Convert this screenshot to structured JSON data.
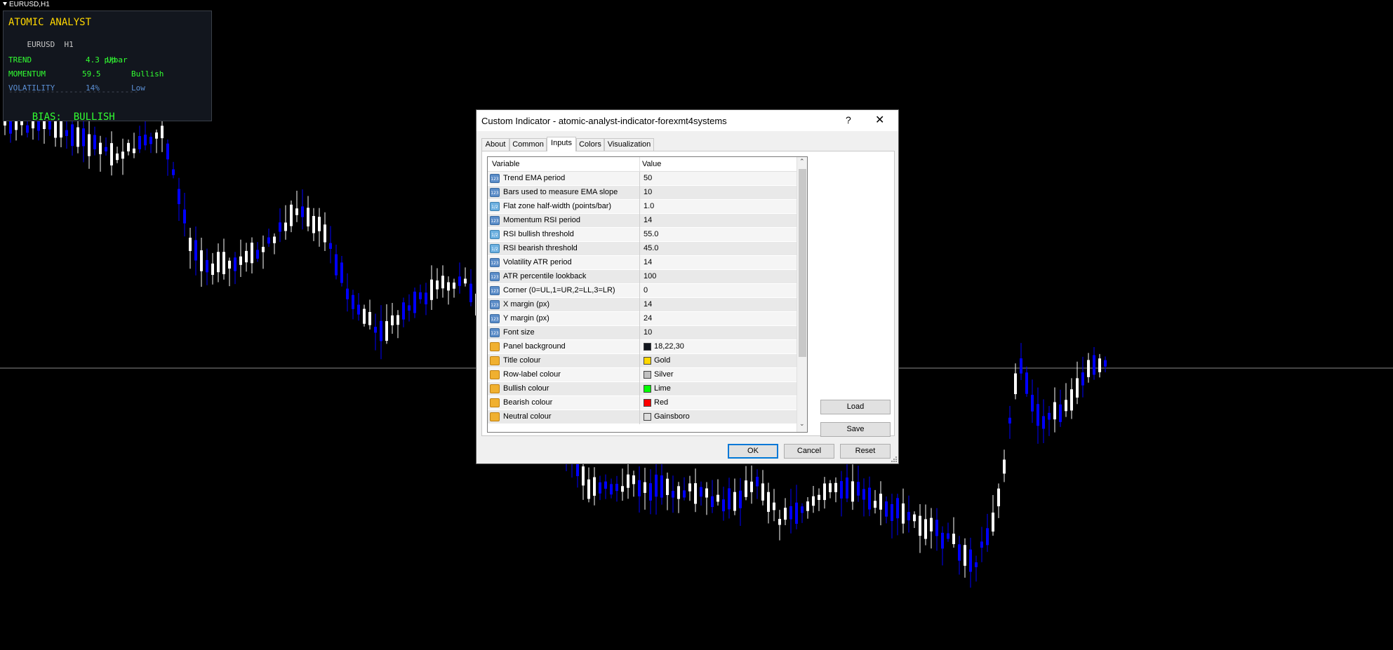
{
  "chart": {
    "symbol_label": "EURUSD,H1",
    "colors": {
      "bull": "#ffffff",
      "bear": "#0000ff",
      "background": "#000000",
      "crosshair": "#c0c0c0"
    }
  },
  "panel": {
    "title": "ATOMIC ANALYST",
    "symbol": "EURUSD",
    "timeframe": "H1",
    "rows": [
      {
        "label": "TREND",
        "value": "4.3 p/bar",
        "status": "Up",
        "color": "#32ff32"
      },
      {
        "label": "MOMENTUM",
        "value": "59.5",
        "status": "Bullish",
        "color": "#32ff32"
      },
      {
        "label": "VOLATILITY",
        "value": "14%",
        "status": "Low",
        "color": "#5b8fd4"
      }
    ],
    "separator": "----------------------------",
    "bias_label": "BIAS:",
    "bias_value": "BULLISH",
    "colors": {
      "title": "#ffd700",
      "background": "#12161e"
    }
  },
  "dialog": {
    "title": "Custom Indicator - atomic-analyst-indicator-forexmt4systems",
    "help_label": "?",
    "close_label": "✕",
    "tabs": [
      "About",
      "Common",
      "Inputs",
      "Colors",
      "Visualization"
    ],
    "active_tab": "Inputs",
    "columns": {
      "variable": "Variable",
      "value": "Value"
    },
    "params": [
      {
        "type": "int",
        "icon": "123",
        "name": "Trend EMA period",
        "value": "50"
      },
      {
        "type": "int",
        "icon": "123",
        "name": "Bars used to measure EMA slope",
        "value": "10"
      },
      {
        "type": "double",
        "icon": "1/2",
        "name": "Flat zone half-width (points/bar)",
        "value": "1.0"
      },
      {
        "type": "int",
        "icon": "123",
        "name": "Momentum RSI period",
        "value": "14"
      },
      {
        "type": "double",
        "icon": "1/2",
        "name": "RSI bullish threshold",
        "value": "55.0"
      },
      {
        "type": "double",
        "icon": "1/2",
        "name": "RSI bearish threshold",
        "value": "45.0"
      },
      {
        "type": "int",
        "icon": "123",
        "name": "Volatility ATR period",
        "value": "14"
      },
      {
        "type": "int",
        "icon": "123",
        "name": "ATR percentile lookback",
        "value": "100"
      },
      {
        "type": "int",
        "icon": "123",
        "name": "Corner (0=UL,1=UR,2=LL,3=LR)",
        "value": "0"
      },
      {
        "type": "int",
        "icon": "123",
        "name": "X margin (px)",
        "value": "14"
      },
      {
        "type": "int",
        "icon": "123",
        "name": "Y margin (px)",
        "value": "24"
      },
      {
        "type": "int",
        "icon": "123",
        "name": "Font size",
        "value": "10"
      },
      {
        "type": "color",
        "icon": "",
        "name": "Panel background",
        "value": "18,22,30",
        "swatch": "#12161e"
      },
      {
        "type": "color",
        "icon": "",
        "name": "Title colour",
        "value": "Gold",
        "swatch": "#ffd700"
      },
      {
        "type": "color",
        "icon": "",
        "name": "Row-label colour",
        "value": "Silver",
        "swatch": "#c0c0c0"
      },
      {
        "type": "color",
        "icon": "",
        "name": "Bullish colour",
        "value": "Lime",
        "swatch": "#00ff00"
      },
      {
        "type": "color",
        "icon": "",
        "name": "Bearish colour",
        "value": "Red",
        "swatch": "#ff0000"
      },
      {
        "type": "color",
        "icon": "",
        "name": "Neutral colour",
        "value": "Gainsboro",
        "swatch": "#dcdcdc"
      }
    ],
    "buttons": {
      "load": "Load",
      "save": "Save",
      "ok": "OK",
      "cancel": "Cancel",
      "reset": "Reset"
    },
    "scroll_up_glyph": "⌃",
    "scroll_down_glyph": "⌄"
  }
}
